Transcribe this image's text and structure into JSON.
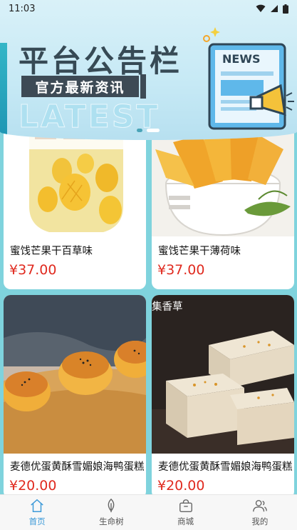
{
  "status_bar": {
    "time": "11:03"
  },
  "banner": {
    "title": "平台公告栏",
    "subtitle": "官方最新资讯",
    "latest": "LATEST",
    "news_badge": "NEWS",
    "carousel": {
      "count": 2,
      "active_index": 1
    }
  },
  "products": [
    {
      "name": "蜜饯芒果干百草味",
      "price": "¥37.00"
    },
    {
      "name": "蜜饯芒果干薄荷味",
      "price": "¥37.00"
    },
    {
      "name": "麦德优蛋黄酥雪媚娘海鸭蛋糕",
      "price": "¥20.00"
    },
    {
      "name": "麦德优蛋黄酥雪媚娘海鸭蛋糕",
      "price": "¥20.00",
      "photo_label": "集香草"
    }
  ],
  "tabbar": {
    "active_index": 0,
    "tabs": [
      {
        "label": "首页",
        "icon": "home-icon"
      },
      {
        "label": "生命树",
        "icon": "leaf-icon"
      },
      {
        "label": "商城",
        "icon": "shop-bag-icon"
      },
      {
        "label": "我的",
        "icon": "users-icon"
      }
    ],
    "active_color": "#3d9ad8"
  },
  "colors": {
    "price": "#e02a1f",
    "background": "#7fd3dd"
  }
}
